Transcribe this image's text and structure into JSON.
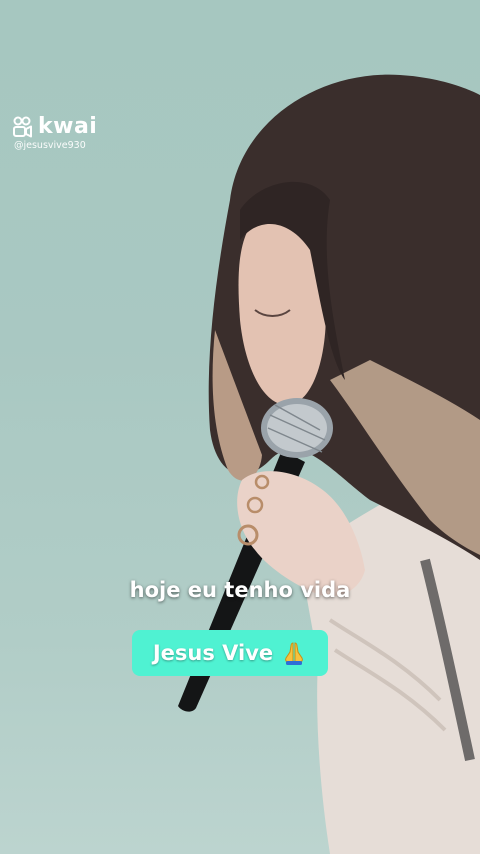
{
  "watermark": {
    "brand": "kwai",
    "handle": "@jesusvive930",
    "logo_icon": "kwai-logo-icon"
  },
  "caption": {
    "text": "hoje eu tenho vida"
  },
  "badge": {
    "text": "Jesus Vive",
    "icon": "praying-hands-emoji",
    "background": "#4ff2d2"
  },
  "colors": {
    "background": "#a9c8c2",
    "text": "#ffffff"
  }
}
